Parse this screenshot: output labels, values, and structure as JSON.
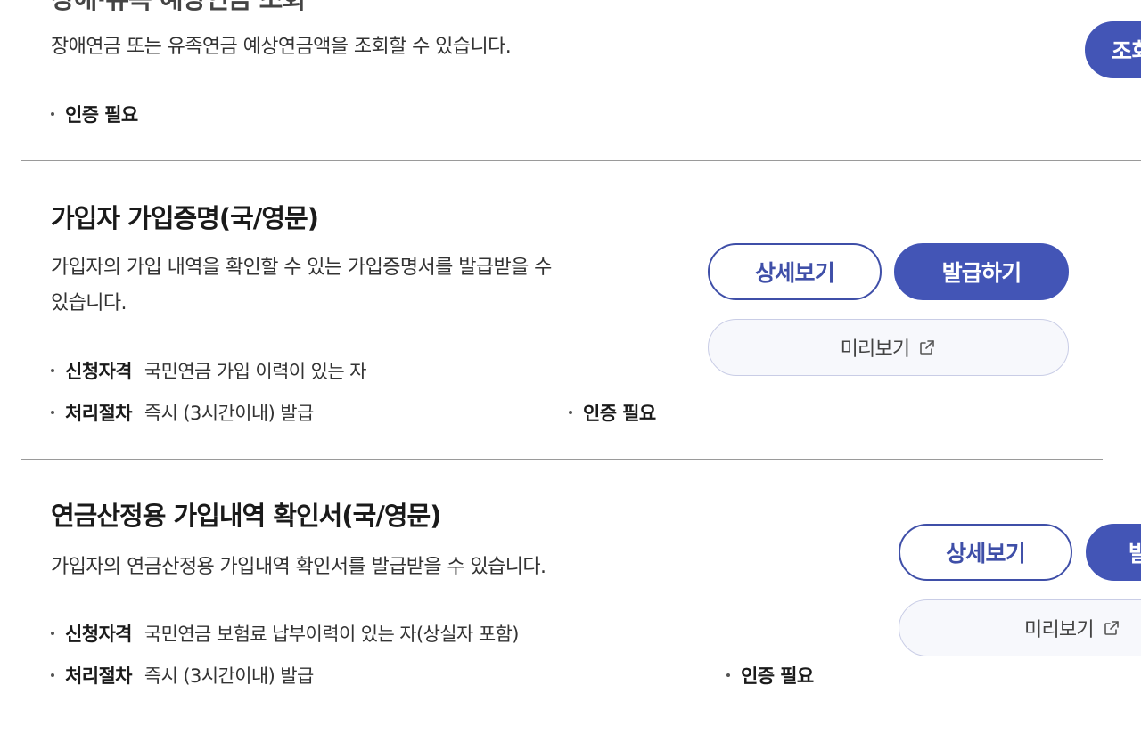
{
  "section1": {
    "title": "장애·유족 예상연금 조회",
    "description": "장애연금 또는 유족연금 예상연금액을 조회할 수 있습니다.",
    "auth": "인증 필요",
    "inquiry_label": "조회"
  },
  "section2": {
    "title": "가입자 가입증명(국/영문)",
    "description_line1": "가입자의 가입 내역을 확인할 수 있는 가입증명서를 발급받을 수",
    "description_line2": "있습니다.",
    "eligibility_label": "신청자격",
    "eligibility_value": "국민연금 가입 이력이 있는 자",
    "procedure_label": "처리절차",
    "procedure_value": "즉시 (3시간이내) 발급",
    "auth": "인증 필요",
    "detail_label": "상세보기",
    "issue_label": "발급하기",
    "preview_label": "미리보기"
  },
  "section3": {
    "title": "연금산정용 가입내역 확인서(국/영문)",
    "description": "가입자의 연금산정용 가입내역 확인서를 발급받을 수 있습니다.",
    "eligibility_label": "신청자격",
    "eligibility_value": "국민연금 보험료 납부이력이 있는 자(상실자 포함)",
    "procedure_label": "처리절차",
    "procedure_value": "즉시 (3시간이내) 발급",
    "auth": "인증 필요",
    "detail_label": "상세보기",
    "issue_label": "발급하기",
    "preview_label": "미리보기"
  },
  "icons": {
    "external": "external-link-icon"
  },
  "colors": {
    "primary": "#4355b6",
    "primary_border": "#3f4fa8",
    "preview_bg": "#f7f8fc",
    "preview_border": "#c9cde6",
    "divider": "#9a9a9a"
  }
}
